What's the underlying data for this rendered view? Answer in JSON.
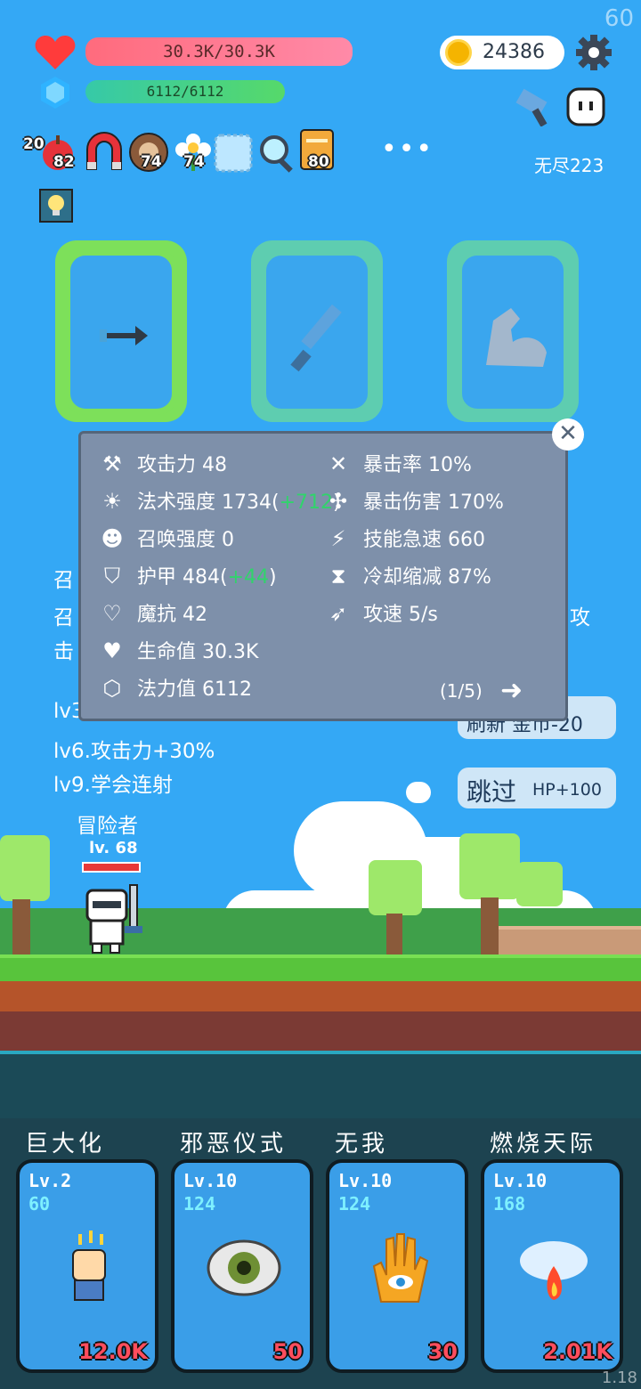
{
  "hud": {
    "fps": "60",
    "hp_text": "30.3K/30.3K",
    "mp_text": "6112/6112",
    "gold": "24386",
    "mode": "无尽223",
    "version": "1.18"
  },
  "items": [
    {
      "icon": "apple-icon",
      "badge_left": "20",
      "badge": "82"
    },
    {
      "icon": "magnet-icon",
      "badge": ""
    },
    {
      "icon": "shield-ring-icon",
      "badge": "74"
    },
    {
      "icon": "flower-icon",
      "badge": "74"
    },
    {
      "icon": "ice-cube-icon",
      "badge": ""
    },
    {
      "icon": "magnifier-icon",
      "badge": ""
    },
    {
      "icon": "book-icon",
      "badge": "80"
    }
  ],
  "stats_panel": {
    "left": [
      {
        "icon": "axe-icon",
        "label": "攻击力",
        "value": "48",
        "bonus": ""
      },
      {
        "icon": "sun-icon",
        "label": "法术强度",
        "value": "1734",
        "bonus": "+712"
      },
      {
        "icon": "summon-icon",
        "label": "召唤强度",
        "value": "0",
        "bonus": ""
      },
      {
        "icon": "shield-icon",
        "label": "护甲",
        "value": "484",
        "bonus": "+44"
      },
      {
        "icon": "heart-shield-icon",
        "label": "魔抗",
        "value": "42",
        "bonus": ""
      },
      {
        "icon": "heart-icon",
        "label": "生命值",
        "value": "30.3K",
        "bonus": ""
      },
      {
        "icon": "crystal-icon",
        "label": "法力值",
        "value": "6112",
        "bonus": ""
      }
    ],
    "right": [
      {
        "icon": "crit-icon",
        "label": "暴击率",
        "value": "10%"
      },
      {
        "icon": "crit-damage-icon",
        "label": "暴击伤害",
        "value": "170%"
      },
      {
        "icon": "lightning-icon",
        "label": "技能急速",
        "value": "660"
      },
      {
        "icon": "hourglass-icon",
        "label": "冷却缩减",
        "value": "87%"
      },
      {
        "icon": "bow-icon",
        "label": "攻速",
        "value": "5/s"
      }
    ],
    "page": "(1/5)"
  },
  "left_text": {
    "line1": "召",
    "line2": "召",
    "line3": "击",
    "right_char": "攻",
    "lv3": "lv3",
    "lv6": "lv6.攻击力+30%",
    "lv9": "lv9.学会连射"
  },
  "buttons": {
    "refresh": "刷新 金币-20",
    "skip_main": "跳过",
    "skip_bonus": "HP+100"
  },
  "hero": {
    "name": "冒险者",
    "level": "lv. 68"
  },
  "skills": [
    {
      "title": "巨大化",
      "level": "Lv.2",
      "cost": "60",
      "price": "12.0K",
      "icon": "fist-icon"
    },
    {
      "title": "邪恶仪式",
      "level": "Lv.10",
      "cost": "124",
      "price": "50",
      "icon": "eye-icon"
    },
    {
      "title": "无我",
      "level": "Lv.10",
      "cost": "124",
      "price": "30",
      "icon": "hand-eye-icon"
    },
    {
      "title": "燃烧天际",
      "level": "Lv.10",
      "cost": "168",
      "price": "2.01K",
      "icon": "fire-cloud-icon"
    }
  ]
}
